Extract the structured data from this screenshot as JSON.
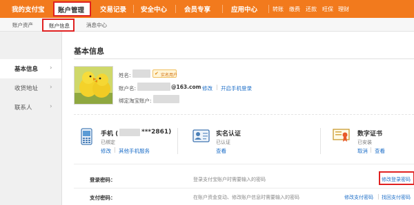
{
  "topnav": {
    "brand": "我的支付宝",
    "active": "账户管理",
    "items": [
      "交易记录",
      "安全中心",
      "会员专享",
      "应用中心"
    ],
    "quick_links": [
      "转账",
      "缴费",
      "还款",
      "旺保",
      "理财"
    ]
  },
  "subnav": {
    "items": [
      "账户资产",
      "账户信息",
      "消息中心"
    ]
  },
  "sidebar": {
    "items": [
      {
        "label": "基本信息"
      },
      {
        "label": "收货地址"
      },
      {
        "label": "联系人"
      }
    ]
  },
  "main": {
    "title": "基本信息",
    "name_label": "姓名:",
    "badge_text": "实名用户",
    "account_label": "账户名:",
    "email_suffix": "@163.com",
    "account_links": [
      "修改",
      "开启手机登录"
    ],
    "taobao_label": "绑定淘宝账户:"
  },
  "cards": [
    {
      "title_prefix": "手机 (",
      "title_suffix": "***2861)",
      "status": "已绑定",
      "links": [
        "修改",
        "其他手机服务"
      ]
    },
    {
      "title": "实名认证",
      "status": "已认证",
      "links": [
        "查看"
      ]
    },
    {
      "title": "数字证书",
      "status": "已安装",
      "links": [
        "取消",
        "查看"
      ]
    }
  ],
  "rows": [
    {
      "label": "登录密码：",
      "desc": "登录支付宝账户时需要输入的密码",
      "links": [
        "修改登录密码"
      ]
    },
    {
      "label": "支付密码：",
      "desc": "在账户资金变动、修改账户信息时需要输入的密码",
      "links": [
        "修改支付密码",
        "找回支付密码"
      ]
    }
  ],
  "colors": {
    "brand_orange": "#f27a1d",
    "link_blue": "#1e6fc8",
    "highlight_red": "#e02020"
  }
}
